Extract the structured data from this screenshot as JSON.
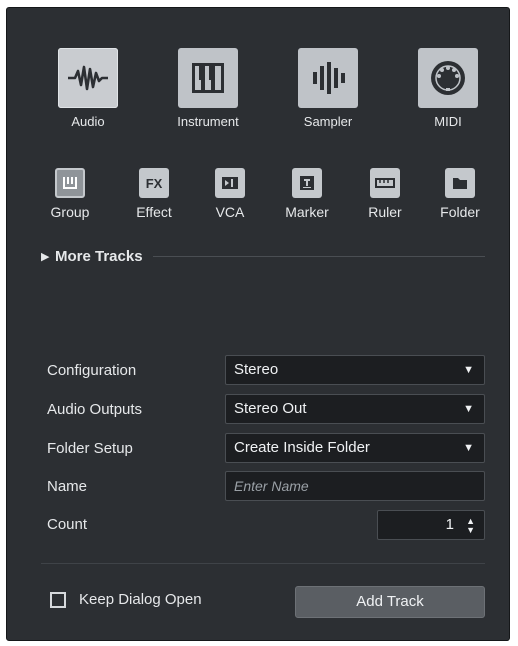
{
  "big_tracks": [
    {
      "label": "Audio",
      "icon": "audio-waveform-icon",
      "selected": true
    },
    {
      "label": "Instrument",
      "icon": "piano-keys-icon",
      "selected": false
    },
    {
      "label": "Sampler",
      "icon": "sampler-bars-icon",
      "selected": false
    },
    {
      "label": "MIDI",
      "icon": "midi-connector-icon",
      "selected": false
    }
  ],
  "small_tracks": [
    {
      "label": "Group",
      "icon": "group-icon"
    },
    {
      "label": "Effect",
      "icon": "fx-icon",
      "icon_text": "FX"
    },
    {
      "label": "VCA",
      "icon": "vca-icon"
    },
    {
      "label": "Marker",
      "icon": "marker-icon"
    },
    {
      "label": "Ruler",
      "icon": "ruler-icon"
    },
    {
      "label": "Folder",
      "icon": "folder-icon"
    }
  ],
  "more_tracks": {
    "label": "More Tracks"
  },
  "fields": {
    "configuration": {
      "label": "Configuration",
      "value": "Stereo"
    },
    "audio_outputs": {
      "label": "Audio Outputs",
      "value": "Stereo Out"
    },
    "folder_setup": {
      "label": "Folder Setup",
      "value": "Create Inside Folder"
    },
    "name": {
      "label": "Name",
      "placeholder": "Enter Name"
    },
    "count": {
      "label": "Count",
      "value": "1"
    }
  },
  "footer": {
    "keep_open_label": "Keep Dialog Open",
    "keep_open_checked": false,
    "add_button_label": "Add Track"
  },
  "colors": {
    "background": "#2c2f33",
    "tile": "#bfc3c8",
    "icon_dark": "#2c2f33"
  }
}
